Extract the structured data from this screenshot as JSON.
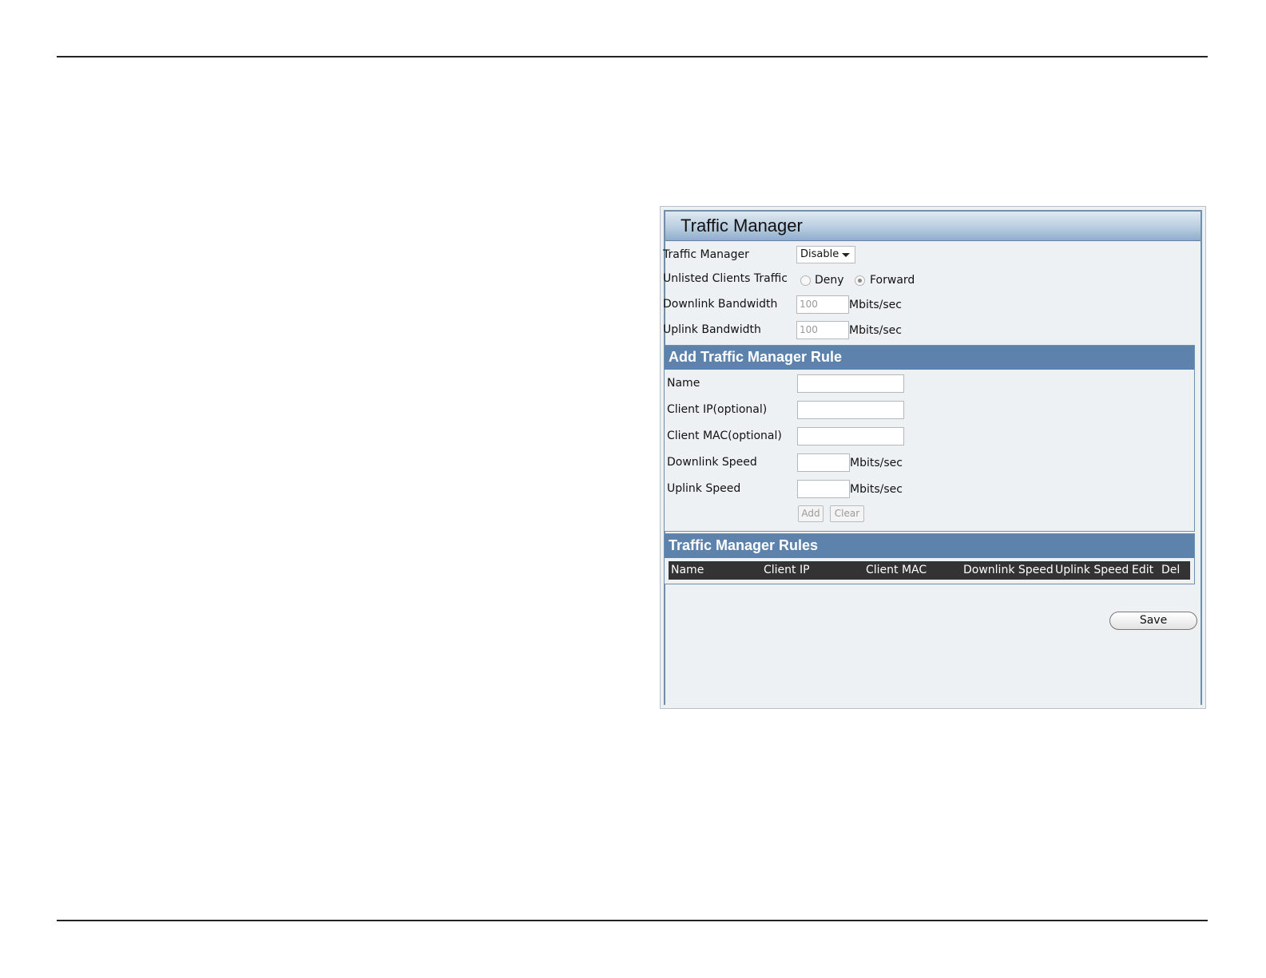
{
  "panel": {
    "title": "Traffic Manager"
  },
  "settings": {
    "traffic_manager_label": "Traffic Manager",
    "traffic_manager_value": "Disable",
    "unlisted_label": "Unlisted Clients Traffic",
    "deny_label": "Deny",
    "forward_label": "Forward",
    "unlisted_selected": "Forward",
    "downlink_bw_label": "Downlink Bandwidth",
    "downlink_bw_value": "100",
    "uplink_bw_label": "Uplink Bandwidth",
    "uplink_bw_value": "100",
    "unit": "Mbits/sec"
  },
  "add_rule": {
    "title": "Add Traffic Manager Rule",
    "name_label": "Name",
    "client_ip_label": "Client IP(optional)",
    "client_mac_label": "Client MAC(optional)",
    "downlink_label": "Downlink Speed",
    "uplink_label": "Uplink Speed",
    "unit": "Mbits/sec",
    "add_button": "Add",
    "clear_button": "Clear"
  },
  "rules": {
    "title": "Traffic Manager Rules",
    "columns": [
      "Name",
      "Client IP",
      "Client MAC",
      "Downlink Speed",
      "Uplink Speed",
      "Edit",
      "Del"
    ]
  },
  "save_button": "Save"
}
